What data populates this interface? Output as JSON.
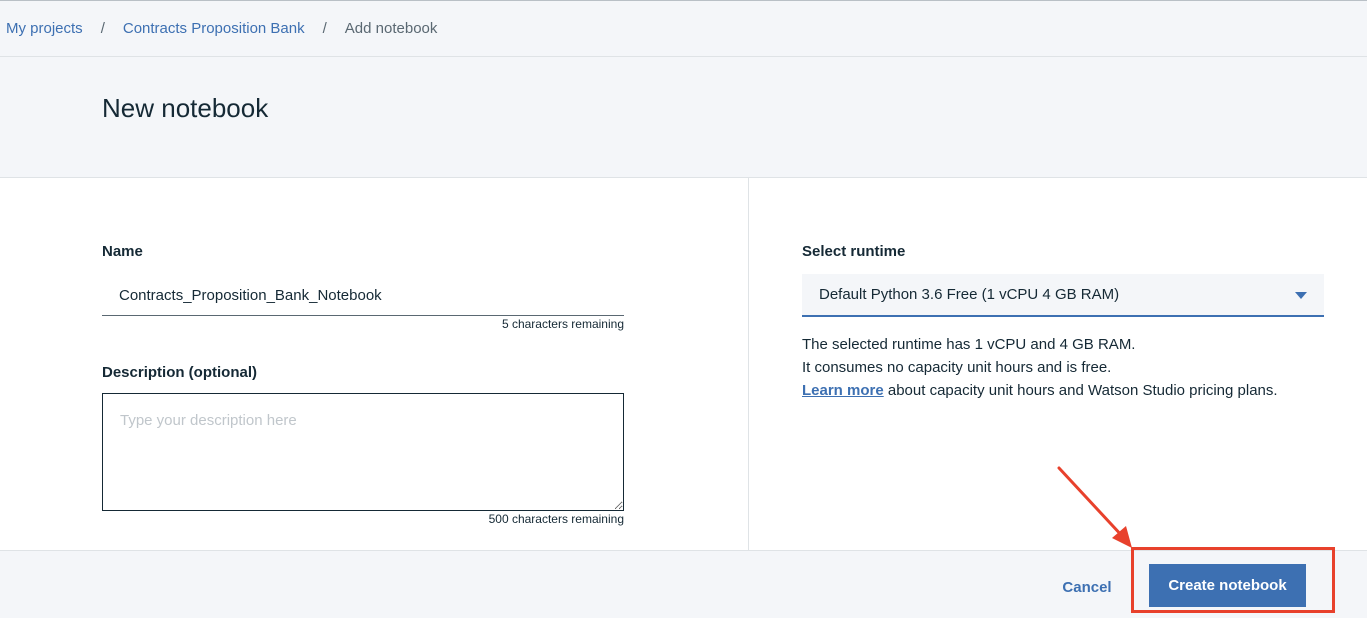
{
  "breadcrumb": {
    "items": [
      "My projects",
      "Contracts Proposition Bank"
    ],
    "current": "Add notebook",
    "separator": "/"
  },
  "page": {
    "title": "New notebook"
  },
  "form": {
    "name_label": "Name",
    "name_value": "Contracts_Proposition_Bank_Notebook",
    "name_helper": "5 characters remaining",
    "description_label": "Description (optional)",
    "description_placeholder": "Type your description here",
    "description_helper": "500 characters remaining"
  },
  "runtime": {
    "label": "Select runtime",
    "selected": "Default Python 3.6 Free (1 vCPU 4 GB RAM)",
    "info_line1": "The selected runtime has 1 vCPU and 4 GB RAM.",
    "info_line2": "It consumes no capacity unit hours and is free.",
    "learn_more_link": "Learn more",
    "info_line3_rest": " about capacity unit hours and Watson Studio pricing plans."
  },
  "footer": {
    "cancel_label": "Cancel",
    "create_label": "Create notebook"
  },
  "colors": {
    "accent": "#3d70b2",
    "annotation": "#e8412c",
    "background_gray": "#f4f6f9"
  },
  "icons": {
    "select_caret": "caret-down-icon",
    "annotation_arrow": "arrow-icon"
  }
}
